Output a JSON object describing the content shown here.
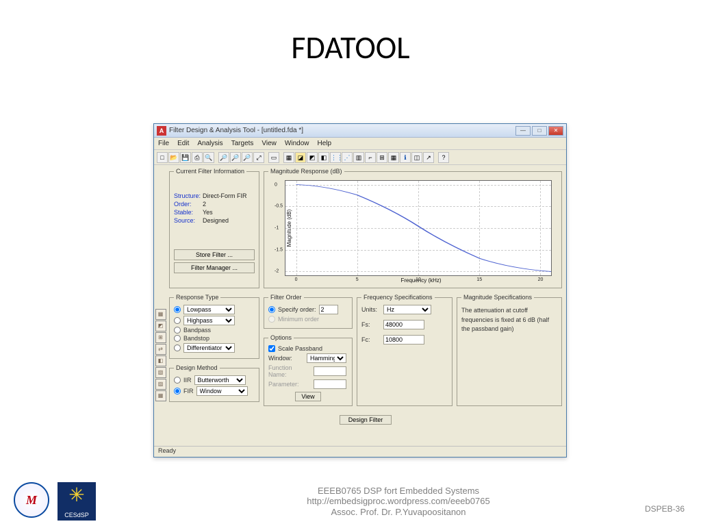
{
  "slide": {
    "title": "FDATOOL"
  },
  "window": {
    "title": "Filter Design & Analysis Tool -  [untitled.fda *]",
    "icon_label": "A"
  },
  "menu": [
    "File",
    "Edit",
    "Analysis",
    "Targets",
    "View",
    "Window",
    "Help"
  ],
  "cfi": {
    "legend": "Current Filter Information",
    "structure_label": "Structure:",
    "structure": "Direct-Form FIR",
    "order_label": "Order:",
    "order": "2",
    "stable_label": "Stable:",
    "stable": "Yes",
    "source_label": "Source:",
    "source": "Designed",
    "store_btn": "Store Filter ...",
    "manager_btn": "Filter Manager ..."
  },
  "mag": {
    "legend": "Magnitude Response (dB)",
    "ylabel": "Magnitude (dB)",
    "xlabel": "Frequency (kHz)"
  },
  "chart_data": {
    "type": "line",
    "xlabel": "Frequency (kHz)",
    "ylabel": "Magnitude (dB)",
    "x": [
      0,
      5,
      10,
      15,
      20
    ],
    "y": [
      0,
      -0.25,
      -0.95,
      -1.7,
      -2.0
    ],
    "xlim": [
      0,
      21.5
    ],
    "ylim": [
      -2.1,
      0.1
    ],
    "yticks": [
      0,
      -0.5,
      -1,
      -1.5,
      -2
    ],
    "xticks": [
      0,
      5,
      10,
      15,
      20
    ]
  },
  "response_type": {
    "legend": "Response Type",
    "opts": [
      "Lowpass",
      "Highpass",
      "Bandpass",
      "Bandstop",
      "Differentiator"
    ],
    "selected": "Lowpass"
  },
  "design_method": {
    "legend": "Design Method",
    "iir_label": "IIR",
    "iir_val": "Butterworth",
    "fir_label": "FIR",
    "fir_val": "Window",
    "selected": "FIR"
  },
  "filter_order": {
    "legend": "Filter Order",
    "specify_label": "Specify order:",
    "specify_val": "2",
    "min_label": "Minimum order"
  },
  "options": {
    "legend": "Options",
    "scale_label": "Scale Passband",
    "window_label": "Window:",
    "window_val": "Hamming",
    "fn_label": "Function Name:",
    "param_label": "Parameter:",
    "view_btn": "View"
  },
  "freq": {
    "legend": "Frequency Specifications",
    "units_label": "Units:",
    "units_val": "Hz",
    "fs_label": "Fs:",
    "fs_val": "48000",
    "fc_label": "Fc:",
    "fc_val": "10800"
  },
  "magspec": {
    "legend": "Magnitude Specifications",
    "note": "The attenuation at cutoff frequencies is fixed at 6 dB (half the passband gain)"
  },
  "design_btn": "Design Filter",
  "status": "Ready",
  "footer": {
    "line1": "EEEB0765  DSP fort Embedded Systems",
    "line2": "http://embedsigproc.wordpress.com/eeeb0765",
    "line3": "Assoc. Prof. Dr. P.Yuvapoositanon",
    "logo2_text": "CESdSP",
    "page_prefix": "DSPEB-",
    "page_num": "36"
  }
}
